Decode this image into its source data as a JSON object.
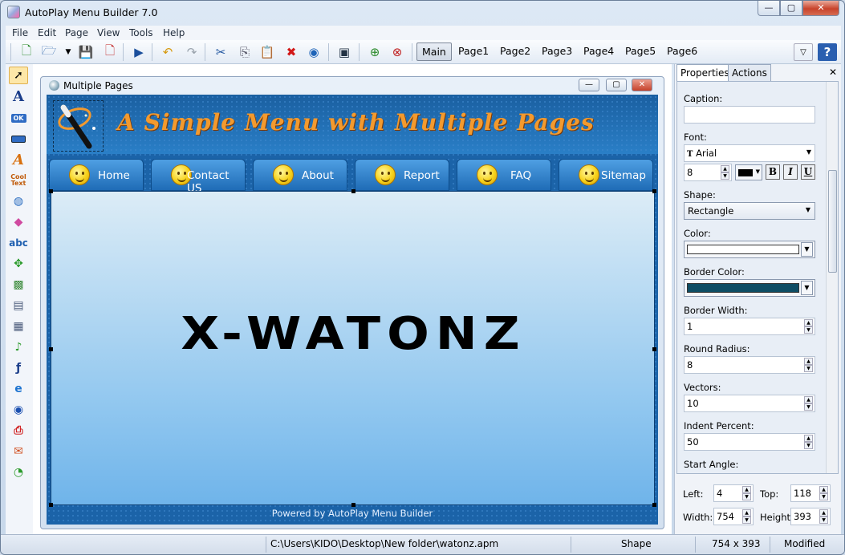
{
  "app": {
    "title": "AutoPlay Menu Builder 7.0"
  },
  "window_controls": {
    "min": "—",
    "max": "▢",
    "close": "✕"
  },
  "menu": [
    "File",
    "Edit",
    "Page",
    "View",
    "Tools",
    "Help"
  ],
  "page_tabs": [
    "Main",
    "Page1",
    "Page2",
    "Page3",
    "Page4",
    "Page5",
    "Page6"
  ],
  "active_tab": "Main",
  "doc": {
    "title": "Multiple Pages",
    "headline": "A Simple Menu with Multiple Pages",
    "nav": [
      "Home",
      "Contact US",
      "About",
      "Report",
      "FAQ",
      "Sitemap"
    ],
    "big_text": "X-WATONZ",
    "footer": "Powered by AutoPlay Menu Builder"
  },
  "panel": {
    "tabs": [
      "Properties",
      "Actions"
    ],
    "caption_label": "Caption:",
    "caption_value": "",
    "font_label": "Font:",
    "font_value": "Arial",
    "font_size": "8",
    "bold": "B",
    "italic": "I",
    "underline": "U",
    "shape_label": "Shape:",
    "shape_value": "Rectangle",
    "color_label": "Color:",
    "border_color_label": "Border Color:",
    "border_width_label": "Border Width:",
    "border_width": "1",
    "round_radius_label": "Round Radius:",
    "round_radius": "8",
    "vectors_label": "Vectors:",
    "vectors": "10",
    "indent_label": "Indent Percent:",
    "indent": "50",
    "start_angle_label": "Start Angle:",
    "left_label": "Left:",
    "left": "4",
    "top_label": "Top:",
    "top": "118",
    "width_label": "Width:",
    "width": "754",
    "height_label": "Height:",
    "height": "393"
  },
  "status": {
    "path": "C:\\Users\\KIDO\\Desktop\\New folder\\watonz.apm",
    "object": "Shape",
    "size": "754 x 393",
    "state": "Modified"
  },
  "colors": {
    "shape_fill": "#ffffff",
    "border": "#0e4d64",
    "accent": "#f39a2e"
  }
}
